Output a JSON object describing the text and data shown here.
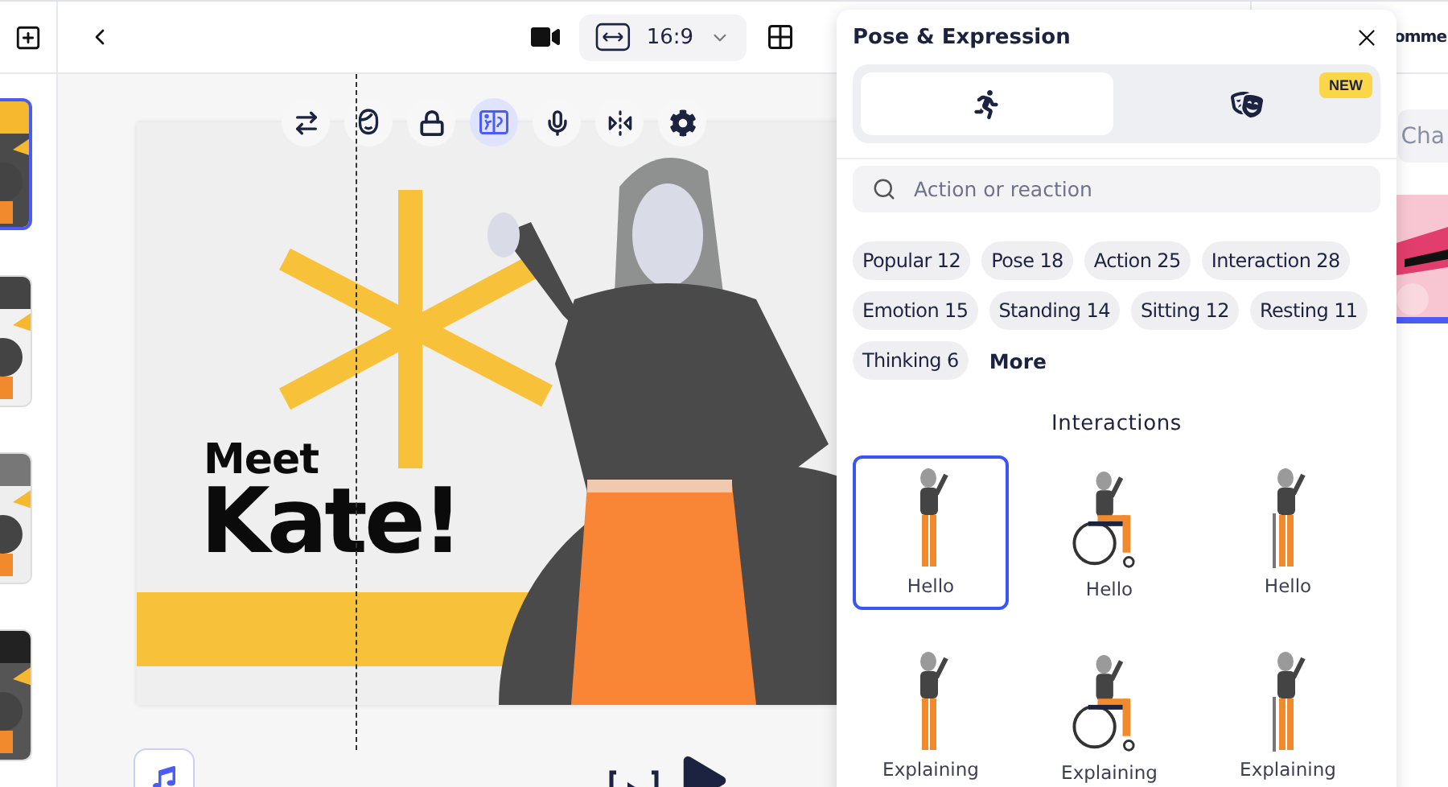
{
  "top_bar": {
    "aspect_ratio": "16:9"
  },
  "slide": {
    "heading": "Meet",
    "name": "Kate!"
  },
  "toolbar": [
    {
      "kind": "swap",
      "selected": false
    },
    {
      "kind": "face",
      "selected": false
    },
    {
      "kind": "lock",
      "selected": false
    },
    {
      "kind": "pose",
      "selected": true
    },
    {
      "kind": "mic",
      "selected": false
    },
    {
      "kind": "flip",
      "selected": false
    },
    {
      "kind": "settings",
      "selected": false
    }
  ],
  "panel": {
    "title": "Pose & Expression",
    "tabs": [
      {
        "kind": "pose",
        "selected": true
      },
      {
        "kind": "expression",
        "selected": false,
        "badge": "NEW"
      }
    ],
    "search": {
      "placeholder": "Action or reaction"
    },
    "chips": [
      "Popular 12",
      "Pose 18",
      "Action 25",
      "Interaction 28",
      "Emotion 15",
      "Standing 14",
      "Sitting 12",
      "Resting 11",
      "Thinking 6"
    ],
    "more": "More",
    "section": "Interactions",
    "poses": [
      {
        "label": "Hello",
        "kind": "standing",
        "selected": true
      },
      {
        "label": "Hello",
        "kind": "wheelchair",
        "selected": false
      },
      {
        "label": "Hello",
        "kind": "crutches",
        "selected": false
      },
      {
        "label": "Explaining",
        "kind": "standing",
        "selected": false
      },
      {
        "label": "Explaining",
        "kind": "wheelchair",
        "selected": false
      },
      {
        "label": "Explaining",
        "kind": "crutches",
        "selected": false
      }
    ]
  },
  "side_panel": {
    "title": "omme",
    "search": "Cha"
  }
}
